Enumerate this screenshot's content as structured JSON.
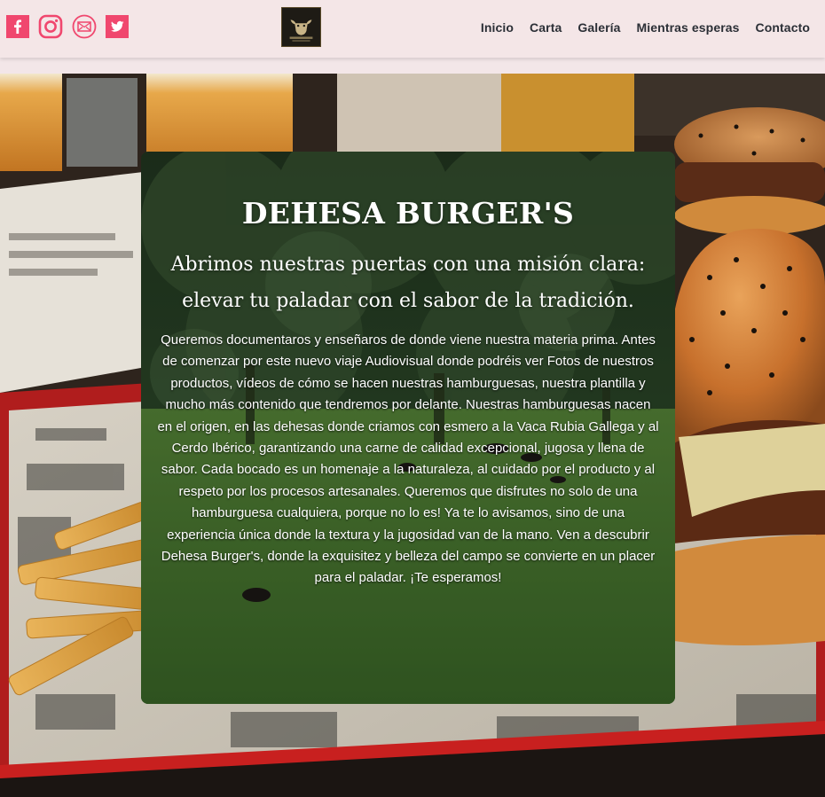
{
  "header": {
    "socials": [
      {
        "name": "facebook",
        "icon": "facebook-icon"
      },
      {
        "name": "instagram",
        "icon": "instagram-icon"
      },
      {
        "name": "email",
        "icon": "mail-icon"
      },
      {
        "name": "twitter",
        "icon": "twitter-icon"
      }
    ],
    "social_color": "#f0476e",
    "nav": [
      {
        "label": "Inicio"
      },
      {
        "label": "Carta"
      },
      {
        "label": "Galería"
      },
      {
        "label": "Mientras esperas"
      },
      {
        "label": "Contacto"
      }
    ]
  },
  "hero": {
    "title": "DEHESA BURGER'S",
    "subtitle": "Abrimos nuestras puertas con una misión clara: elevar tu paladar con el sabor de la tradición.",
    "body": "Queremos documentaros y enseñaros de donde viene nuestra materia prima. Antes de comenzar por este nuevo viaje Audiovisual donde podréis ver Fotos de nuestros productos, vídeos de cómo se hacen nuestras hamburguesas, nuestra plantilla y mucho más contenido que tendremos por delante. Nuestras hamburguesas nacen en el origen, en las dehesas donde criamos con esmero a la Vaca Rubia Gallega y al Cerdo Ibérico, garantizando una carne de calidad excepcional, jugosa y llena de sabor. Cada bocado es un homenaje a la naturaleza, al cuidado por el producto y al respeto por los procesos artesanales. Queremos que disfrutes no solo de una hamburguesa cualquiera, porque no lo es! Ya te lo avisamos, sino de una experiencia única donde la textura y la jugosidad van de la mano. Ven a descubrir Dehesa Burger's, donde la exquisitez y belleza del campo se convierte en un placer para el paladar. ¡Te esperamos!"
  },
  "colors": {
    "header_bg": "#f4e6e7",
    "nav_text": "#2b2f36",
    "social_accent": "#f0476e"
  }
}
